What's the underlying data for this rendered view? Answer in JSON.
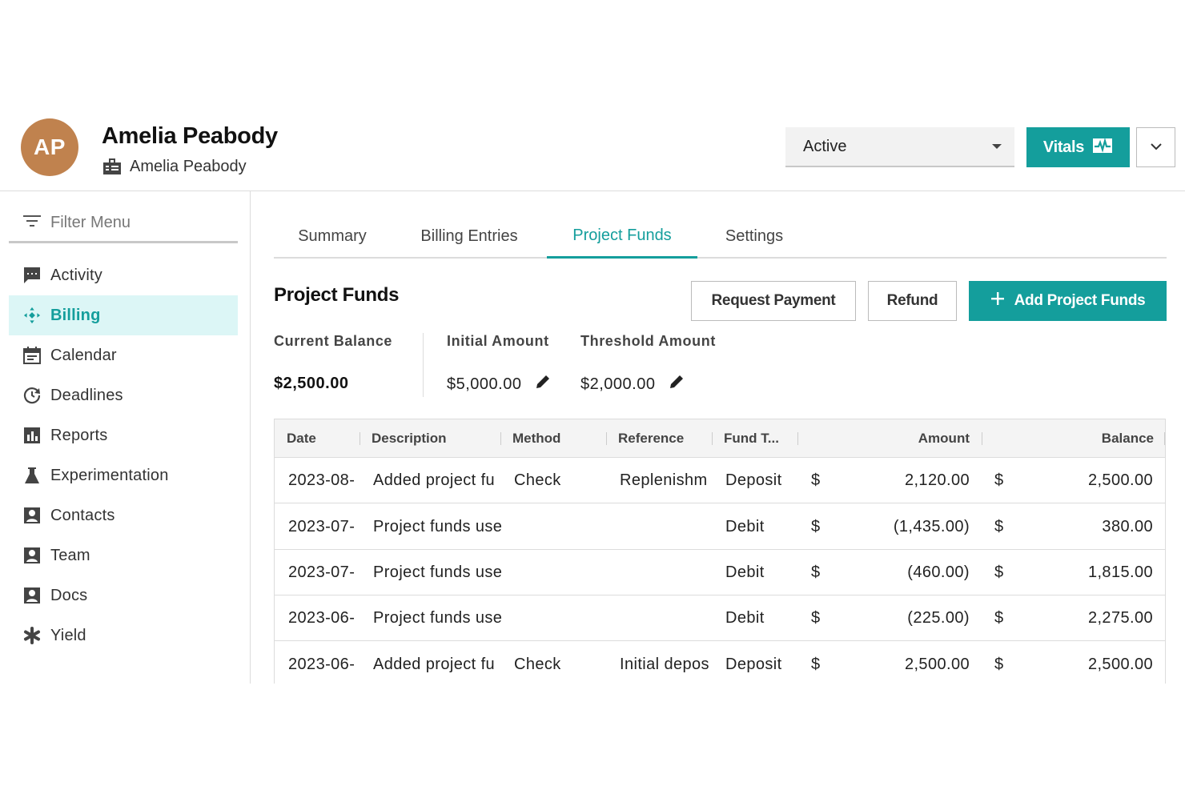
{
  "header": {
    "avatar_initials": "AP",
    "client_name": "Amelia Peabody",
    "client_sub": "Amelia Peabody",
    "client_sub_icon": "building-id-icon",
    "status": {
      "value": "Active"
    },
    "vitals_label": "Vitals",
    "vitals_icon": "pulse-icon",
    "more_icon": "chevron-down-icon"
  },
  "colors": {
    "accent": "#149e9c",
    "avatar": "#c0824e",
    "active_bg": "#dcf6f6"
  },
  "sidebar": {
    "filter_label": "Filter Menu",
    "items": [
      {
        "label": "Activity",
        "icon": "chat-icon",
        "active": false
      },
      {
        "label": "Billing",
        "icon": "billing-icon",
        "active": true
      },
      {
        "label": "Calendar",
        "icon": "calendar-icon",
        "active": false
      },
      {
        "label": "Deadlines",
        "icon": "clock-icon",
        "active": false
      },
      {
        "label": "Reports",
        "icon": "bar-chart-icon",
        "active": false
      },
      {
        "label": "Experimentation",
        "icon": "flask-icon",
        "active": false
      },
      {
        "label": "Contacts",
        "icon": "contact-card-icon",
        "active": false
      },
      {
        "label": "Team",
        "icon": "contact-card-icon",
        "active": false
      },
      {
        "label": "Docs",
        "icon": "contact-card-icon",
        "active": false
      },
      {
        "label": "Yield",
        "icon": "asterisk-icon",
        "active": false
      }
    ]
  },
  "tabs": [
    {
      "label": "Summary",
      "active": false
    },
    {
      "label": "Billing Entries",
      "active": false
    },
    {
      "label": "Project Funds",
      "active": true
    },
    {
      "label": "Settings",
      "active": false
    }
  ],
  "section": {
    "title": "Project Funds",
    "request_payment_label": "Request Payment",
    "refund_label": "Refund",
    "add_funds_label": "Add Project Funds"
  },
  "stats": {
    "current_balance_label": "Current Balance",
    "current_balance_value": "$2,500.00",
    "initial_amount_label": "Initial Amount",
    "initial_amount_value": "$5,000.00",
    "threshold_amount_label": "Threshold Amount",
    "threshold_amount_value": "$2,000.00"
  },
  "table": {
    "columns": [
      "Date",
      "Description",
      "Method",
      "Reference",
      "Fund T...",
      "Amount",
      "Balance"
    ],
    "rows": [
      {
        "date": "2023-08-",
        "description": "Added project fu",
        "method": "Check",
        "reference": "Replenishm",
        "fund_type": "Deposit",
        "amount_cur": "$",
        "amount": "2,120.00",
        "balance_cur": "$",
        "balance": "2,500.00"
      },
      {
        "date": "2023-07-",
        "description": "Project funds use",
        "method": "",
        "reference": "",
        "fund_type": "Debit",
        "amount_cur": "$",
        "amount": "(1,435.00)",
        "balance_cur": "$",
        "balance": "380.00"
      },
      {
        "date": "2023-07-",
        "description": "Project funds use",
        "method": "",
        "reference": "",
        "fund_type": "Debit",
        "amount_cur": "$",
        "amount": "(460.00)",
        "balance_cur": "$",
        "balance": "1,815.00"
      },
      {
        "date": "2023-06-",
        "description": "Project funds use",
        "method": "",
        "reference": "",
        "fund_type": "Debit",
        "amount_cur": "$",
        "amount": "(225.00)",
        "balance_cur": "$",
        "balance": "2,275.00"
      },
      {
        "date": "2023-06-",
        "description": "Added project fu",
        "method": "Check",
        "reference": "Initial depos",
        "fund_type": "Deposit",
        "amount_cur": "$",
        "amount": "2,500.00",
        "balance_cur": "$",
        "balance": "2,500.00"
      }
    ]
  }
}
